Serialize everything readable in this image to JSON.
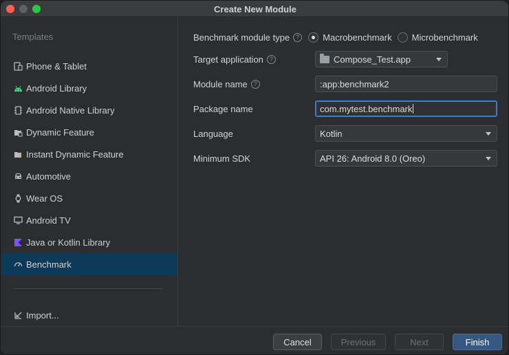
{
  "window": {
    "title": "Create New Module"
  },
  "sidebar": {
    "header": "Templates",
    "items": [
      {
        "label": "Phone & Tablet",
        "icon": "phone-tablet-icon"
      },
      {
        "label": "Android Library",
        "icon": "android-icon"
      },
      {
        "label": "Android Native Library",
        "icon": "native-library-icon"
      },
      {
        "label": "Dynamic Feature",
        "icon": "dynamic-feature-icon"
      },
      {
        "label": "Instant Dynamic Feature",
        "icon": "instant-feature-icon"
      },
      {
        "label": "Automotive",
        "icon": "car-icon"
      },
      {
        "label": "Wear OS",
        "icon": "watch-icon"
      },
      {
        "label": "Android TV",
        "icon": "tv-icon"
      },
      {
        "label": "Java or Kotlin Library",
        "icon": "kotlin-icon"
      },
      {
        "label": "Benchmark",
        "icon": "gauge-icon",
        "selected": true
      }
    ],
    "import_label": "Import..."
  },
  "form": {
    "benchmark_type": {
      "label": "Benchmark module type",
      "options": [
        "Macrobenchmark",
        "Microbenchmark"
      ],
      "selected": "Macrobenchmark"
    },
    "target_application": {
      "label": "Target application",
      "value": "Compose_Test.app"
    },
    "module_name": {
      "label": "Module name",
      "value": ":app:benchmark2"
    },
    "package_name": {
      "label": "Package name",
      "value": "com.mytest.benchmark"
    },
    "language": {
      "label": "Language",
      "value": "Kotlin"
    },
    "minimum_sdk": {
      "label": "Minimum SDK",
      "value": "API 26: Android 8.0 (Oreo)"
    }
  },
  "footer": {
    "cancel": "Cancel",
    "previous": "Previous",
    "next": "Next",
    "finish": "Finish"
  },
  "colors": {
    "selection": "#0d3a58",
    "focus_border": "#3d7cc9",
    "primary_button": "#365880",
    "android_green": "#3ddc84",
    "kotlin_purple": "#7f52ff"
  }
}
